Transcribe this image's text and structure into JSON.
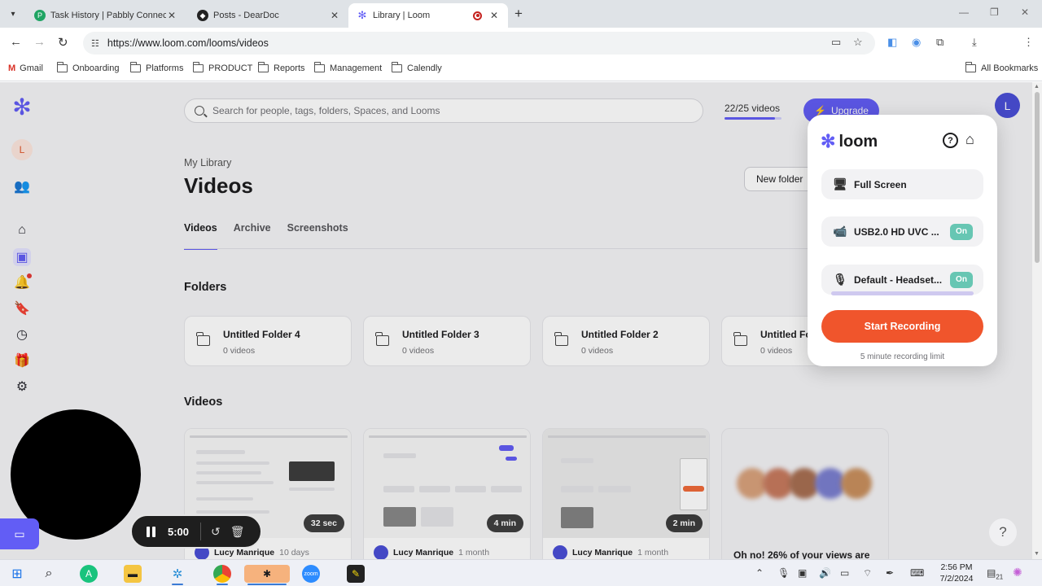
{
  "browser": {
    "tabs": [
      {
        "title": "Task History | Pabbly Connect",
        "favicon_letter": "P",
        "active": false
      },
      {
        "title": "Posts - DearDoc",
        "active": false
      },
      {
        "title": "Library | Loom",
        "active": true,
        "recording": true
      }
    ],
    "url": "https://www.loom.com/looms/videos",
    "bookmarks": [
      "Gmail",
      "Onboarding",
      "Platforms",
      "PRODUCT",
      "Reports",
      "Management",
      "Calendly"
    ],
    "all_bookmarks": "All Bookmarks"
  },
  "sidebar": {
    "avatar_initial": "L"
  },
  "topbar": {
    "search_placeholder": "Search for people, tags, folders, Spaces, and Looms",
    "quota": "22/25 videos",
    "quota_fraction": 0.88,
    "upgrade_label": "Upgrade",
    "user_initial": "L"
  },
  "library": {
    "breadcrumb": "My Library",
    "title": "Videos",
    "new_folder_label": "New folder",
    "tabs": [
      "Videos",
      "Archive",
      "Screenshots"
    ],
    "active_tab": "Videos",
    "folders_heading": "Folders",
    "folders": [
      {
        "name": "Untitled Folder 4",
        "count": "0 videos"
      },
      {
        "name": "Untitled Folder 3",
        "count": "0 videos"
      },
      {
        "name": "Untitled Folder 2",
        "count": "0 videos"
      },
      {
        "name": "Untitled Fo",
        "count": "0 videos"
      }
    ],
    "videos_heading": "Videos",
    "videos": [
      {
        "duration": "32 sec",
        "author": "Lucy Manrique",
        "time": "10 days"
      },
      {
        "duration": "4 min",
        "author": "Lucy Manrique",
        "time": "1 month"
      },
      {
        "duration": "2 min",
        "author": "Lucy Manrique",
        "time": "1 month"
      }
    ],
    "promo_text": "Oh no! 26% of your views are"
  },
  "recorder": {
    "brand": "loom",
    "options": [
      {
        "label": "Full Screen",
        "icon": "monitor-icon"
      },
      {
        "label": "USB2.0 HD UVC ...",
        "icon": "camera-icon",
        "toggle": "On"
      },
      {
        "label": "Default - Headset...",
        "icon": "microphone-icon",
        "toggle": "On"
      }
    ],
    "start_label": "Start Recording",
    "limit_text": "5 minute recording limit"
  },
  "recording_controls": {
    "timer": "5:00"
  },
  "help_label": "?",
  "taskbar": {
    "time": "2:56 PM",
    "date": "7/2/2024",
    "notification_count": "21"
  },
  "colors": {
    "loom_purple": "#625df5",
    "record_orange": "#f0552c",
    "toggle_teal": "#67c6b3"
  }
}
